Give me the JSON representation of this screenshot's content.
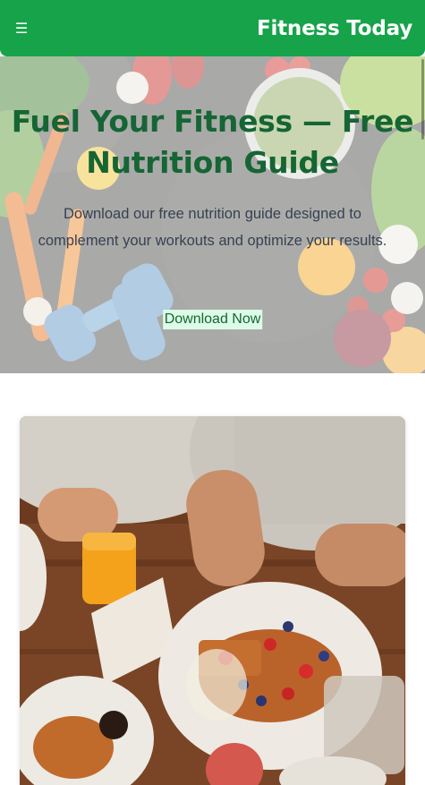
{
  "header": {
    "menu_icon": "☰",
    "brand": "Fitness Today",
    "bg_color": "#16a34a"
  },
  "hero": {
    "title": "Fuel Your Fitness — Free Nutrition Guide",
    "description": "Download our free nutrition guide designed to complement your workouts and optimize your results.",
    "cta_label": "Download Now",
    "title_color": "#166534",
    "background": "vegetables-and-dumbbells-photo"
  },
  "feature_image": {
    "subject": "people-eating-waffles-with-berries-photo"
  }
}
